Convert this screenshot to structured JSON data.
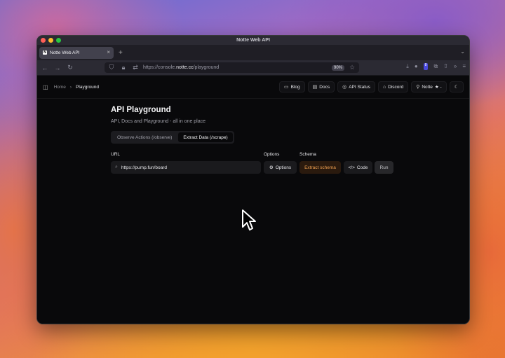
{
  "window": {
    "title": "Notte Web API"
  },
  "tabs": [
    {
      "label": "Notte Web API",
      "favicon": "N"
    }
  ],
  "urlbar": {
    "prefix": "https://console.",
    "domain": "notte.cc",
    "path": "/playground",
    "zoom": "90%"
  },
  "nav_badge": "8",
  "breadcrumb": {
    "home": "Home",
    "separator": "›",
    "current": "Playground"
  },
  "header_actions": [
    {
      "label": "Blog",
      "icon": "book-icon",
      "glyph": "▭"
    },
    {
      "label": "Docs",
      "icon": "document-icon",
      "glyph": "▤"
    },
    {
      "label": "API Status",
      "icon": "status-check-icon",
      "glyph": "◎"
    },
    {
      "label": "Discord",
      "icon": "discord-icon",
      "glyph": "⌂"
    },
    {
      "label": "Notte",
      "icon": "github-icon",
      "glyph": "⚲",
      "suffix": "★ -"
    }
  ],
  "theme_icon": "moon-icon",
  "main": {
    "title": "API Playground",
    "subtitle": "API, Docs and Playground - all in one place",
    "segments": [
      {
        "label": "Observe Actions (/observe)",
        "active": false
      },
      {
        "label": "Extract Data (/scrape)",
        "active": true
      }
    ],
    "labels": {
      "url": "URL",
      "options": "Options",
      "schema": "Schema"
    },
    "url_value": "https://pump.fun/board",
    "buttons": {
      "options": "Options",
      "extract_schema": "Extract schema",
      "code": "Code",
      "run": "Run"
    }
  },
  "colors": {
    "accent_orange": "#f0a050",
    "page_bg": "#09090b"
  }
}
